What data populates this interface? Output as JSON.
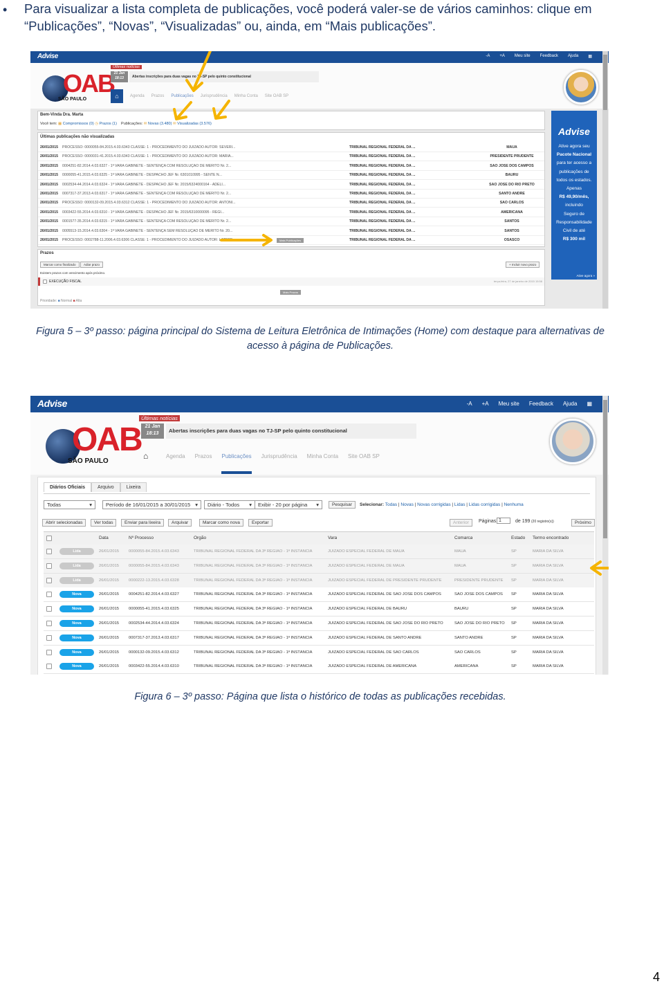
{
  "intro": {
    "bullet": "•",
    "text": "Para visualizar a lista completa de publicações, você poderá valer-se de vários caminhos: clique em “Publicações”, “Novas”, “Visualizadas” ou, ainda, em “Mais publicações”."
  },
  "app": {
    "brand": "Advise",
    "top_links": [
      "-A",
      "+A",
      "Meu site",
      "Feedback",
      "Ajuda"
    ],
    "logo_text": "OAB",
    "logo_sub": "SÃO PAULO",
    "news_tag": "Últimas notícias",
    "news_date_day": "21 Jan",
    "news_date_time": "18:13",
    "news_headline": "Abertas inscrições para duas vagas no TJ-SP pelo quinto constitucional",
    "nav": [
      "Agenda",
      "Prazos",
      "Publicações",
      "Jurisprudência",
      "Minha Conta",
      "Site OAB SP"
    ]
  },
  "fig5": {
    "caption": "Figura 5 – 3º passo: página principal do Sistema de Leitura Eletrônica de Intimações (Home) com destaque para alternativas de acesso à página de Publicações.",
    "welcome": "Bem-Vinda Dra. Marta",
    "voce_tem": "Você tem:",
    "compromissos": "Compromissos (0)",
    "prazos_count": "Prazos (1)",
    "publicacoes_label": "Publicações:",
    "novas": "Novas (3.480)",
    "visualizadas": "Visualizadas (3.576)",
    "list_title": "Últimas publicações não visualizadas",
    "rows": [
      {
        "date": "26/01/2015",
        "desc": "PROCESSO: 0000055-84.2015.4.03.6343 CLASSE: 1 - PROCEDIMENTO DO JUIZADO AUTOR: SEVERI...",
        "orgao": "TRIBUNAL REGIONAL FEDERAL DA ...",
        "city": "MAUÁ"
      },
      {
        "date": "26/01/2015",
        "desc": "PROCESSO: 0000031-41.2015.4.03.6343 CLASSE: 1 - PROCEDIMENTO DO JUIZADO AUTOR: MARIA...",
        "orgao": "TRIBUNAL REGIONAL FEDERAL DA ...",
        "city": "PRESIDENTE PRUDENTE"
      },
      {
        "date": "26/01/2015",
        "desc": "0004251-82.2014.4.03.6327 - 1ª VARA GABINETE - SENTENÇA COM RESOLUÇÃO DE MÉRITO Nr. 2...",
        "orgao": "TRIBUNAL REGIONAL FEDERAL DA ...",
        "city": "SÃO JOSÉ DOS CAMPOS"
      },
      {
        "date": "26/01/2015",
        "desc": "0000055-41.2015.4.03.6325 - 1ª VARA GABINETE - DESPACHO JEF Nr. 6301010995 - SENTE N...",
        "orgao": "TRIBUNAL REGIONAL FEDERAL DA ...",
        "city": "BAURU"
      },
      {
        "date": "26/01/2015",
        "desc": "0002534-44.2014.4.03.6324 - 1ª VARA GABINETE - DESPACHO JEF Nr. 2015/6324000164 - ADELI...",
        "orgao": "TRIBUNAL REGIONAL FEDERAL DA ...",
        "city": "SÃO JOSÉ DO RIO PRETO"
      },
      {
        "date": "26/01/2015",
        "desc": "0007317-37.2013.4.03.6317 - 1ª VARA GABINETE - SENTENÇA COM RESOLUÇÃO DE MÉRITO Nr. 2...",
        "orgao": "TRIBUNAL REGIONAL FEDERAL DA ...",
        "city": "SANTO ANDRÉ"
      },
      {
        "date": "26/01/2015",
        "desc": "PROCESSO: 0000132-09.2015.4.03.6312 CLASSE: 1 - PROCEDIMENTO DO JUIZADO AUTOR: ANTONI...",
        "orgao": "TRIBUNAL REGIONAL FEDERAL DA ...",
        "city": "SÃO CARLOS"
      },
      {
        "date": "26/01/2015",
        "desc": "0003422-55.2014.4.03.6310 - 1ª VARA GABINETE - DESPACHO JEF Nr. 2015/6310000095 - REGI...",
        "orgao": "TRIBUNAL REGIONAL FEDERAL DA ...",
        "city": "AMERICANA"
      },
      {
        "date": "26/01/2015",
        "desc": "0001577-35.2014.4.03.6315 - 1ª VARA GABINETE - SENTENÇA COM RESOLUÇÃO DE MÉRITO Nr. 2...",
        "orgao": "TRIBUNAL REGIONAL FEDERAL DA ...",
        "city": "SANTOS"
      },
      {
        "date": "26/01/2015",
        "desc": "0005513-15.2014.4.03.6304 - 1ª VARA GABINETE - SENTENÇA SEM RESOLUÇÃO DE MÉRITO Nr. 20...",
        "orgao": "TRIBUNAL REGIONAL FEDERAL DA ...",
        "city": "SANTOS"
      },
      {
        "date": "26/01/2015",
        "desc": "PROCESSO: 0002788-11.2006.4.03.6306 CLASSE: 1 - PROCEDIMENTO DO JUIZADO AUTOR: LATERF...",
        "orgao": "TRIBUNAL REGIONAL FEDERAL DA ...",
        "city": "OSASCO"
      }
    ],
    "mais_publicacoes": "Mais Publicações",
    "prazos_title": "Prazos",
    "marcar_finalizado": "Marcar como finalizado",
    "adiar_prazo": "Adiar prazo",
    "incluir_prazo": "+ Incluir novo prazo",
    "existem_prazos": "Existem prazos com vencimento após próximo.",
    "prazo_item": "EXECUÇÃO FISCAL",
    "prazo_date": "terça-feira, 27 de janeiro de 2015 15:58",
    "mais_prazos": "Mais Prazos",
    "prioridade": "Prioridade:",
    "normal": "Normal",
    "alta": "Alta",
    "ad_brand": "Advise",
    "ad_lines": [
      "Ative agora seu",
      "Pacote Nacional",
      "para ter acesso a",
      "publicações de",
      "todos os estados.",
      "Apenas",
      "R$ 49,90/mês,",
      "incluindo",
      "Seguro de",
      "Responsabilidade",
      "Civil de até",
      "R$ 300 mil"
    ],
    "ad_cta": "Ative agora »",
    "colors": {
      "accent": "#1a4f96",
      "arrow": "#f5b400",
      "ad": "#1f63ba"
    }
  },
  "fig6": {
    "caption": "Figura 6 – 3º passo: Página que lista o histórico de todas as publicações recebidas.",
    "tabs": [
      "Diários Oficiais",
      "Arquivo",
      "Lixeira"
    ],
    "filters": [
      "Todas",
      "Período de 16/01/2015 a 30/01/2015",
      "Diário - Todos",
      "Exibir - 20 por página"
    ],
    "pesquisar": "Pesquisar",
    "selecionar_label": "Selecionar:",
    "selecionar_links": [
      "Todas",
      "Novas",
      "Novas corrigidas",
      "Lidas",
      "Lidas corrigidas",
      "Nenhuma"
    ],
    "actions": [
      "Abrir selecionadas",
      "Ver todas",
      "Enviar para lixeira",
      "Arquivar",
      "Marcar como nova",
      "Exportar"
    ],
    "pager_prev": "Anterior",
    "pager_label": "Páginas:",
    "pager_value": "1",
    "pager_total": "de 199",
    "pager_count": "(20 registro(s))",
    "pager_next": "Próximo",
    "headers": [
      "Data",
      "Nº Processo",
      "Órgão",
      "Vara",
      "Comarca",
      "Estado",
      "Termo encontrado"
    ],
    "rows": [
      {
        "status": "Lida",
        "state": "read",
        "date": "26/01/2015",
        "proc": "0000055-84.2015.4.03.6343",
        "orgao": "TRIBUNAL REGIONAL FEDERAL DA 3ª REGIÃO - 1ª INSTÂNCIA",
        "vara": "JUIZADO ESPECIAL FEDERAL DE MAUÁ",
        "comarca": "MAUÁ",
        "uf": "SP",
        "termo": "MARIA DA SILVA"
      },
      {
        "status": "Lida",
        "state": "read",
        "date": "26/01/2015",
        "proc": "0000055-84.2015.4.03.6343",
        "orgao": "TRIBUNAL REGIONAL FEDERAL DA 3ª REGIÃO - 1ª INSTÂNCIA",
        "vara": "JUIZADO ESPECIAL FEDERAL DE MAUÁ",
        "comarca": "MAUÁ",
        "uf": "SP",
        "termo": "MARIA DA SILVA"
      },
      {
        "status": "Lida",
        "state": "read",
        "date": "26/01/2015",
        "proc": "0000222-13.2015.4.03.6328",
        "orgao": "TRIBUNAL REGIONAL FEDERAL DA 3ª REGIÃO - 1ª INSTÂNCIA",
        "vara": "JUIZADO ESPECIAL FEDERAL DE PRESIDENTE PRUDENTE",
        "comarca": "PRESIDENTE PRUDENTE",
        "uf": "SP",
        "termo": "MARIA DA SILVA"
      },
      {
        "status": "Nova",
        "state": "new",
        "date": "26/01/2015",
        "proc": "0004251-82.2014.4.03.6327",
        "orgao": "TRIBUNAL REGIONAL FEDERAL DA 3ª REGIÃO - 1ª INSTÂNCIA",
        "vara": "JUIZADO ESPECIAL FEDERAL DE SÃO JOSÉ DOS CAMPOS",
        "comarca": "SÃO JOSÉ DOS CAMPOS",
        "uf": "SP",
        "termo": "MARIA DA SILVA"
      },
      {
        "status": "Nova",
        "state": "new",
        "date": "26/01/2015",
        "proc": "0000055-41.2015.4.03.6325",
        "orgao": "TRIBUNAL REGIONAL FEDERAL DA 3ª REGIÃO - 1ª INSTÂNCIA",
        "vara": "JUIZADO ESPECIAL FEDERAL DE BAURU",
        "comarca": "BAURU",
        "uf": "SP",
        "termo": "MARIA DA SILVA"
      },
      {
        "status": "Nova",
        "state": "new",
        "date": "26/01/2015",
        "proc": "0002534-44.2014.4.03.6324",
        "orgao": "TRIBUNAL REGIONAL FEDERAL DA 3ª REGIÃO - 1ª INSTÂNCIA",
        "vara": "JUIZADO ESPECIAL FEDERAL DE SÃO JOSÉ DO RIO PRETO",
        "comarca": "SÃO JOSÉ DO RIO PRETO",
        "uf": "SP",
        "termo": "MARIA DA SILVA"
      },
      {
        "status": "Nova",
        "state": "new",
        "date": "26/01/2015",
        "proc": "0007317-37.2013.4.03.6317",
        "orgao": "TRIBUNAL REGIONAL FEDERAL DA 3ª REGIÃO - 1ª INSTÂNCIA",
        "vara": "JUIZADO ESPECIAL FEDERAL DE SANTO ANDRÉ",
        "comarca": "SANTO ANDRÉ",
        "uf": "SP",
        "termo": "MARIA DA SILVA"
      },
      {
        "status": "Nova",
        "state": "new",
        "date": "26/01/2015",
        "proc": "0000132-09.2015.4.03.6312",
        "orgao": "TRIBUNAL REGIONAL FEDERAL DA 3ª REGIÃO - 1ª INSTÂNCIA",
        "vara": "JUIZADO ESPECIAL FEDERAL DE SÃO CARLOS",
        "comarca": "SÃO CARLOS",
        "uf": "SP",
        "termo": "MARIA DA SILVA"
      },
      {
        "status": "Nova",
        "state": "new",
        "date": "26/01/2015",
        "proc": "0003422-55.2014.4.03.6310",
        "orgao": "TRIBUNAL REGIONAL FEDERAL DA 3ª REGIÃO - 1ª INSTÂNCIA",
        "vara": "JUIZADO ESPECIAL FEDERAL DE AMERICANA",
        "comarca": "AMERICANA",
        "uf": "SP",
        "termo": "MARIA DA SILVA"
      }
    ]
  },
  "page_number": "4"
}
